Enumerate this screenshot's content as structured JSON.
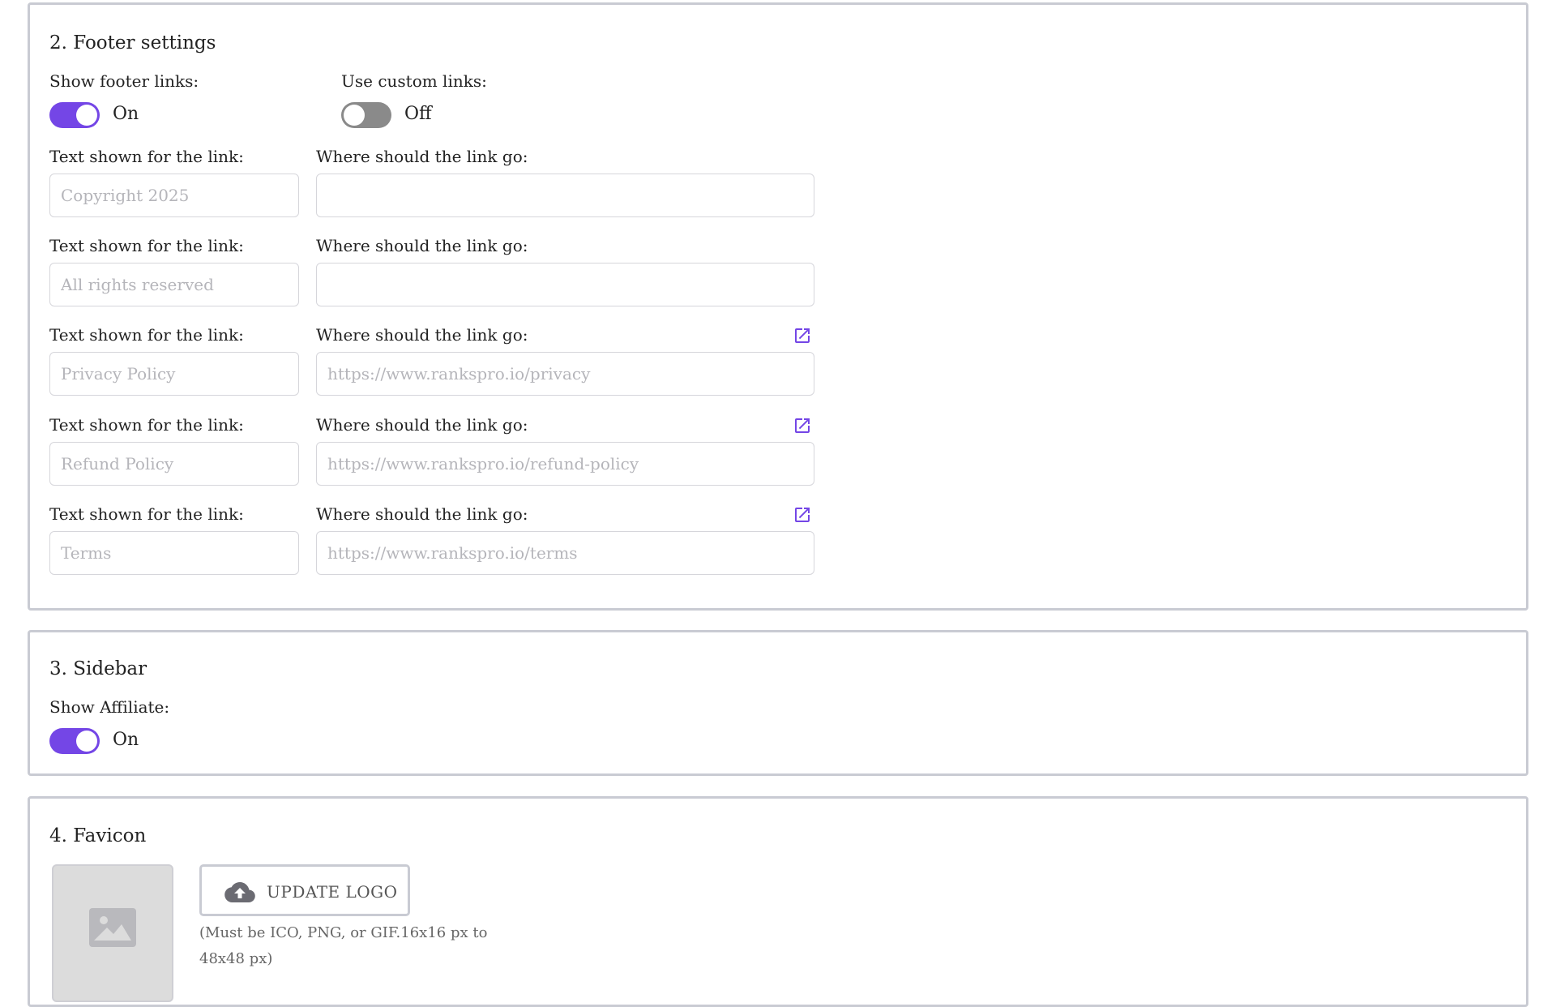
{
  "footer_section": {
    "title": "2. Footer settings",
    "show_footer_links": {
      "label": "Show footer links:",
      "state": "On"
    },
    "use_custom_links": {
      "label": "Use custom links:",
      "state": "Off"
    },
    "rows": [
      {
        "text_label": "Text shown for the link:",
        "text_placeholder": "Copyright 2025",
        "url_label": "Where should the link go:",
        "url_placeholder": ""
      },
      {
        "text_label": "Text shown for the link:",
        "text_placeholder": "All rights reserved",
        "url_label": "Where should the link go:",
        "url_placeholder": ""
      },
      {
        "text_label": "Text shown for the link:",
        "text_placeholder": "Privacy Policy",
        "url_label": "Where should the link go:",
        "url_placeholder": "https://www.rankspro.io/privacy"
      },
      {
        "text_label": "Text shown for the link:",
        "text_placeholder": "Refund Policy",
        "url_label": "Where should the link go:",
        "url_placeholder": "https://www.rankspro.io/refund-policy"
      },
      {
        "text_label": "Text shown for the link:",
        "text_placeholder": "Terms",
        "url_label": "Where should the link go:",
        "url_placeholder": "https://www.rankspro.io/terms"
      }
    ]
  },
  "sidebar_section": {
    "title": "3. Sidebar",
    "show_affiliate": {
      "label": "Show Affiliate:",
      "state": "On"
    }
  },
  "favicon_section": {
    "title": "4. Favicon",
    "update_button": "UPDATE LOGO",
    "hint": "(Must be ICO, PNG, or GIF.16x16 px to 48x48 px)"
  },
  "colors": {
    "accent": "#7446e6",
    "toggle_off": "#8a8a8a",
    "card_border": "#c9cbd3"
  },
  "icons": [
    "external-link-icon",
    "cloud-upload-icon",
    "image-placeholder-icon"
  ]
}
